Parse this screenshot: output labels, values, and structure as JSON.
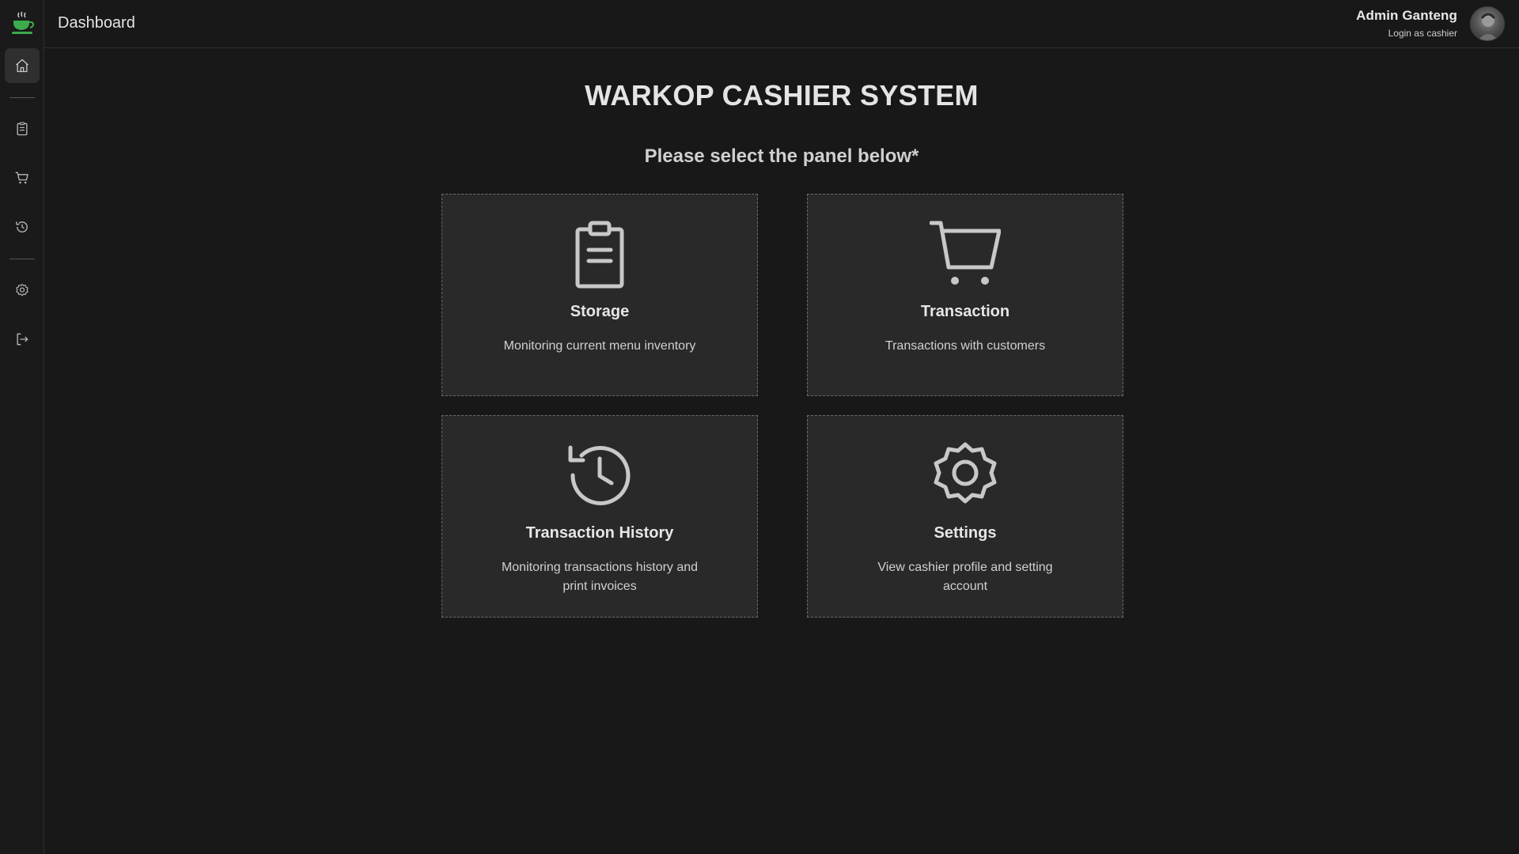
{
  "header": {
    "title": "Dashboard",
    "user_name": "Admin Ganteng",
    "user_role": "Login as cashier"
  },
  "sidebar": {
    "items": [
      {
        "name": "home",
        "icon": "home-icon",
        "active": true
      },
      {
        "name": "storage",
        "icon": "clipboard-icon",
        "active": false
      },
      {
        "name": "transaction",
        "icon": "cart-icon",
        "active": false
      },
      {
        "name": "history",
        "icon": "history-icon",
        "active": false
      },
      {
        "name": "settings",
        "icon": "gear-icon",
        "active": false
      },
      {
        "name": "logout",
        "icon": "logout-icon",
        "active": false
      }
    ]
  },
  "main": {
    "title": "WARKOP CASHIER SYSTEM",
    "subtitle": "Please select the panel below*",
    "panels": [
      {
        "title": "Storage",
        "description": "Monitoring current menu inventory",
        "icon": "clipboard-icon"
      },
      {
        "title": "Transaction",
        "description": "Transactions with customers",
        "icon": "cart-icon"
      },
      {
        "title": "Transaction History",
        "description": "Monitoring transactions history and print invoices",
        "icon": "history-icon"
      },
      {
        "title": "Settings",
        "description": "View cashier profile and setting account",
        "icon": "gear-icon"
      }
    ]
  },
  "colors": {
    "background": "#181818",
    "panel": "#292929",
    "icon": "#c8c8c8",
    "logo_green": "#3cab4b"
  }
}
